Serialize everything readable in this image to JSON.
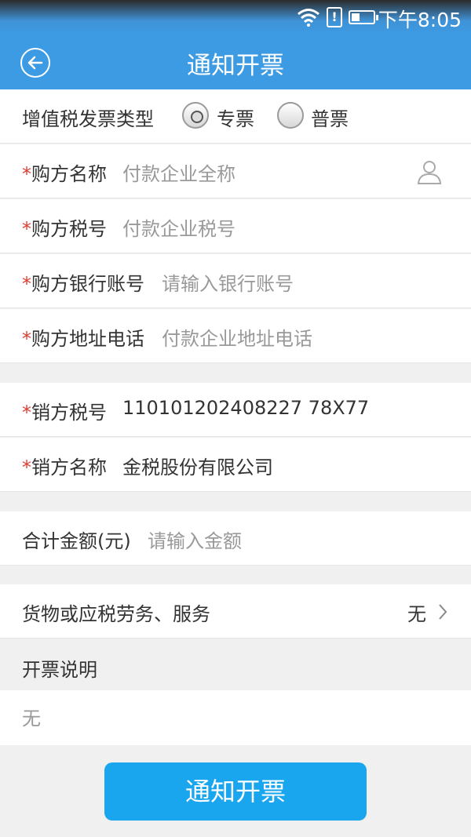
{
  "status_bar": {
    "time": "下午8:05",
    "alert": "!",
    "battery_level": 0.3
  },
  "header": {
    "title": "通知开票"
  },
  "invoice_type": {
    "label": "增值税发票类型",
    "options": [
      {
        "label": "专票",
        "selected": true
      },
      {
        "label": "普票",
        "selected": false
      }
    ]
  },
  "buyer": {
    "name": {
      "required": "*",
      "label": "购方名称",
      "placeholder": "付款企业全称"
    },
    "tax_no": {
      "required": "*",
      "label": "购方税号",
      "placeholder": "付款企业税号"
    },
    "bank_account": {
      "required": "*",
      "label": "购方银行账号",
      "placeholder": "请输入银行账号"
    },
    "address_phone": {
      "required": "*",
      "label": "购方地址电话",
      "placeholder": "付款企业地址电话"
    }
  },
  "seller": {
    "tax_no": {
      "required": "*",
      "label": "销方税号",
      "value": "110101202408227 78X77"
    },
    "name": {
      "required": "*",
      "label": "销方名称",
      "value": "金税股份有限公司"
    }
  },
  "total": {
    "label": "合计金额(元)",
    "placeholder": "请输入金额"
  },
  "goods": {
    "label": "货物或应税劳务、服务",
    "value": "无"
  },
  "note": {
    "label": "开票说明",
    "value": "无"
  },
  "submit": {
    "label": "通知开票"
  },
  "colors": {
    "primary": "#3d9be3",
    "button": "#1aa6ee",
    "required": "#e03c31"
  }
}
